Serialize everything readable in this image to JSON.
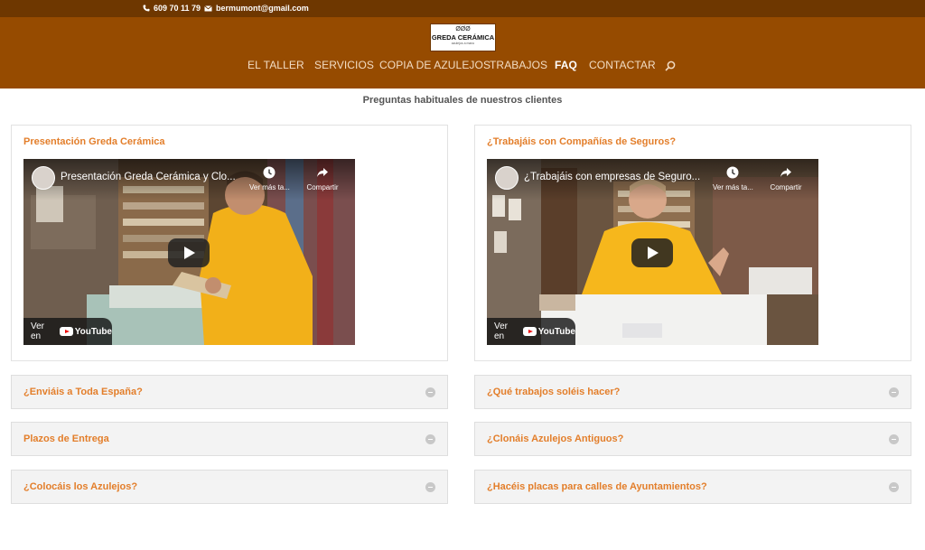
{
  "topbar": {
    "phone": "609 70 11 79",
    "email": "bermumont@gmail.com",
    "phone_icon": "phone-icon",
    "email_icon": "envelope-icon"
  },
  "logo": {
    "rings": "ØØØ",
    "brand": "GREDA CERÁMICA",
    "tagline": "azulejos a mano"
  },
  "nav": {
    "items": [
      "EL TALLER",
      "SERVICIOS",
      "COPIA DE AZULEJOS",
      "TRABAJOS",
      "FAQ",
      "CONTACTAR"
    ],
    "active": "FAQ",
    "search_icon": "search-icon"
  },
  "page": {
    "subtitle": "Preguntas habituales de nuestros clientes"
  },
  "videos": [
    {
      "heading": "Presentación Greda Cerámica",
      "video_title": "Presentación Greda Cerámica y Clo...",
      "watch_later": "Ver más ta...",
      "share": "Compartir",
      "watch_on": "Ver en",
      "brand": "YouTube"
    },
    {
      "heading": "¿Trabajáis con Compañías de Seguros?",
      "video_title": "¿Trabajáis con empresas de Seguro...",
      "watch_later": "Ver más ta...",
      "share": "Compartir",
      "watch_on": "Ver en",
      "brand": "YouTube"
    }
  ],
  "faq": {
    "left": [
      "¿Enviáis a Toda España?",
      "Plazos de Entrega",
      "¿Colocáis los Azulejos?"
    ],
    "right": [
      "¿Qué trabajos soléis hacer?",
      "¿Clonáis Azulejos Antiguos?",
      "¿Hacéis placas para calles de Ayuntamientos?"
    ]
  },
  "colors": {
    "topbar": "#6e3700",
    "header": "#964b00",
    "accent": "#e37e2a"
  }
}
